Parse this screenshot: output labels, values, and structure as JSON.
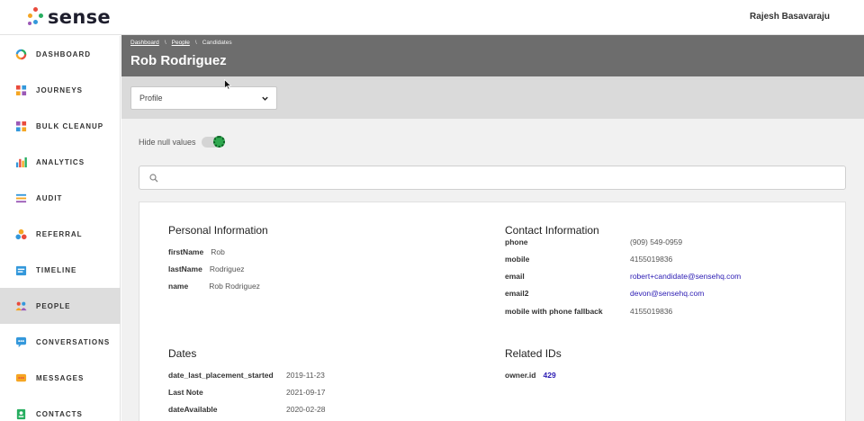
{
  "app": {
    "name": "sense",
    "user": "Rajesh Basavaraju"
  },
  "sidebar": {
    "items": [
      {
        "label": "DASHBOARD",
        "icon": "dashboard-ring-icon"
      },
      {
        "label": "JOURNEYS",
        "icon": "journeys-grid-icon"
      },
      {
        "label": "BULK CLEANUP",
        "icon": "bulk-cleanup-icon"
      },
      {
        "label": "ANALYTICS",
        "icon": "analytics-bars-icon"
      },
      {
        "label": "AUDIT",
        "icon": "audit-list-icon"
      },
      {
        "label": "REFERRAL",
        "icon": "referral-dots-icon"
      },
      {
        "label": "TIMELINE",
        "icon": "timeline-icon"
      },
      {
        "label": "PEOPLE",
        "icon": "people-icon",
        "active": true
      },
      {
        "label": "CONVERSATIONS",
        "icon": "conversations-icon"
      },
      {
        "label": "MESSAGES",
        "icon": "messages-icon"
      },
      {
        "label": "CONTACTS",
        "icon": "contacts-icon"
      }
    ]
  },
  "breadcrumb": {
    "items": [
      "Dashboard",
      "People",
      "Candidates"
    ]
  },
  "page": {
    "title": "Rob Rodriguez"
  },
  "profile_select": {
    "value": "Profile"
  },
  "toggle": {
    "label": "Hide null values",
    "on": true
  },
  "search": {
    "placeholder": "",
    "value": ""
  },
  "personal": {
    "title": "Personal Information",
    "rows": [
      {
        "key": "firstName",
        "value": "Rob"
      },
      {
        "key": "lastName",
        "value": "Rodriguez"
      },
      {
        "key": "name",
        "value": "Rob Rodriguez"
      }
    ]
  },
  "contact": {
    "title": "Contact Information",
    "rows": [
      {
        "key": "phone",
        "value": "(909) 549-0959"
      },
      {
        "key": "mobile",
        "value": "4155019836"
      },
      {
        "key": "email",
        "value": "robert+candidate@sensehq.com"
      },
      {
        "key": "email2",
        "value": "devon@sensehq.com"
      },
      {
        "key": "mobile with phone fallback",
        "value": "4155019836"
      }
    ]
  },
  "dates": {
    "title": "Dates",
    "rows": [
      {
        "key": "date_last_placement_started",
        "value": "2019-11-23"
      },
      {
        "key": "Last Note",
        "value": "2021-09-17"
      },
      {
        "key": "dateAvailable",
        "value": "2020-02-28"
      }
    ]
  },
  "related": {
    "title": "Related IDs",
    "rows": [
      {
        "key": "owner.id",
        "value": "429"
      }
    ]
  },
  "colors": {
    "header": "#6d6d6d",
    "band": "#dadada",
    "active_nav": "#dddddd",
    "link": "#2b1bb3",
    "toggle_on": "#2fa84f"
  }
}
